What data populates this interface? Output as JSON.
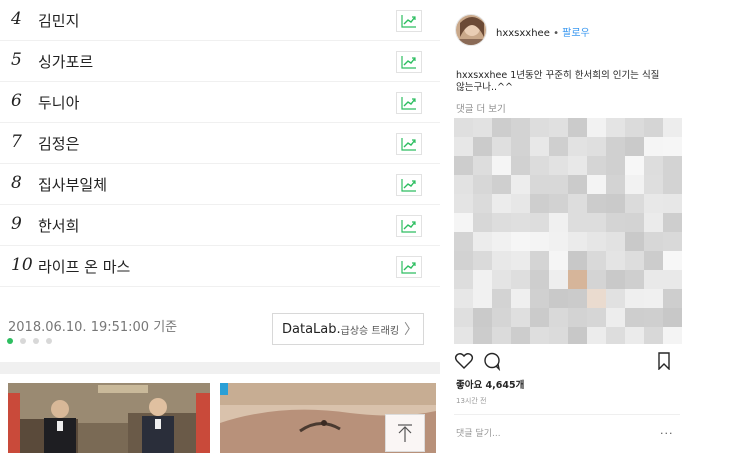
{
  "ranking": {
    "items": [
      {
        "rank": "4",
        "keyword": "김민지"
      },
      {
        "rank": "5",
        "keyword": "싱가포르"
      },
      {
        "rank": "6",
        "keyword": "두니아"
      },
      {
        "rank": "7",
        "keyword": "김정은"
      },
      {
        "rank": "8",
        "keyword": "집사부일체"
      },
      {
        "rank": "9",
        "keyword": "한서희"
      },
      {
        "rank": "10",
        "keyword": "라이프 온 마스"
      }
    ],
    "timestamp": "2018.06.10. 19:51:00 기준",
    "datalab_brand": "DataLab.",
    "datalab_sub": "급상승 트래킹",
    "datalab_chevron": "〉",
    "page_dots_active_index": 0,
    "page_dots_count": 4,
    "accent_color": "#2dbe60",
    "trend_icon": "trend-chart-icon",
    "scroll_top_icon": "arrow-up-icon"
  },
  "instagram": {
    "username": "hxxsxxhee",
    "separator": "•",
    "follow_label": "팔로우",
    "caption_user": "hxxsxxhee",
    "caption_text": "1년동안 꾸준히 한서희의 인기는 식질 않는구나..^^",
    "more_comments": "댓글 더 보기",
    "likes": "좋아요 4,645개",
    "time_ago": "13시간 전",
    "comment_placeholder": "댓글 달기...",
    "options_label": "...",
    "follow_color": "#3897f0"
  }
}
